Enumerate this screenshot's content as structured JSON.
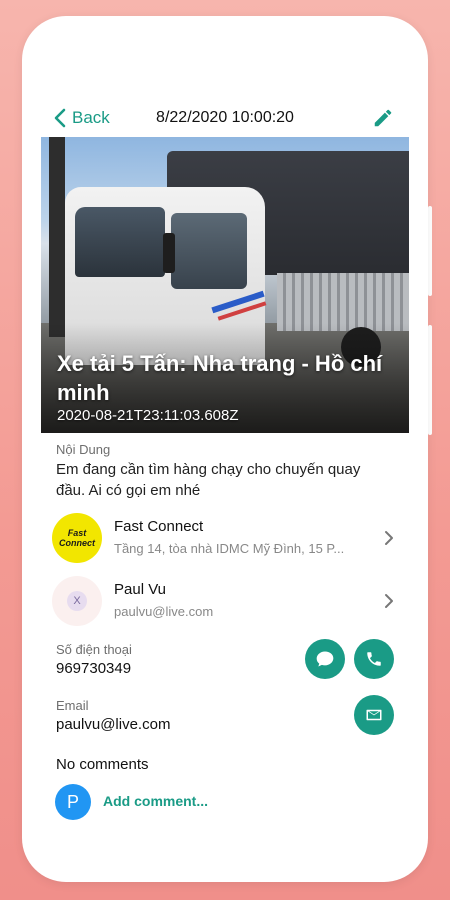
{
  "header": {
    "back_label": "Back",
    "datetime": "8/22/2020 10:00:20"
  },
  "post": {
    "title": "Xe tải 5 Tấn: Nha trang - Hồ chí minh",
    "timestamp": "2020-08-21T23:11:03.608Z",
    "content_label": "Nội Dung",
    "content": "Em đang cần tìm hàng chạy cho chuyến quay đầu. Ai có gọi em nhé"
  },
  "company": {
    "logo_text_1": "Fast",
    "logo_text_2": "Connect",
    "name": "Fast Connect",
    "address": "Tầng 14, tòa nhà IDMC Mỹ Đình, 15 P..."
  },
  "user": {
    "avatar_text": "X",
    "name": "Paul Vu",
    "email": "paulvu@live.com"
  },
  "contact": {
    "phone_label": "Số điện thoại",
    "phone": "969730349",
    "email_label": "Email",
    "email": "paulvu@live.com"
  },
  "comments": {
    "status": "No comments",
    "avatar_letter": "P",
    "add_label": "Add comment..."
  },
  "colors": {
    "accent": "#1a9b86",
    "background": "#f39a93",
    "avatar_blue": "#2196f3",
    "logo_yellow": "#f2e600"
  },
  "icons": [
    "chevron-left-icon",
    "pencil-icon",
    "chevron-right-icon",
    "chat-icon",
    "phone-icon",
    "mail-icon"
  ]
}
